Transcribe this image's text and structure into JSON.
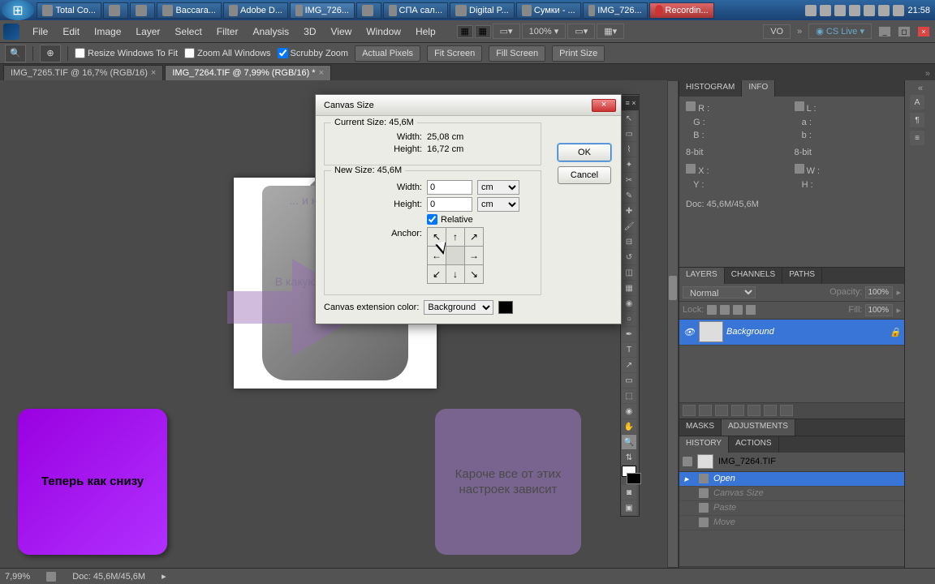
{
  "taskbar": {
    "items": [
      {
        "label": "Total Co..."
      },
      {
        "label": ""
      },
      {
        "label": ""
      },
      {
        "label": "Baccara..."
      },
      {
        "label": "Adobe D..."
      },
      {
        "label": "IMG_726..."
      },
      {
        "label": ""
      },
      {
        "label": "СПА сал..."
      },
      {
        "label": "Digital P..."
      },
      {
        "label": "Сумки - ..."
      },
      {
        "label": "IMG_726..."
      },
      {
        "label": "Recordin..."
      }
    ],
    "clock": "21:58"
  },
  "menu": {
    "items": [
      "File",
      "Edit",
      "Image",
      "Layer",
      "Select",
      "Filter",
      "Analysis",
      "3D",
      "View",
      "Window",
      "Help"
    ],
    "zoom": "100% ▾",
    "cslive": "CS Live ▾",
    "vo": "VO"
  },
  "options": {
    "resize": "Resize Windows To Fit",
    "zoomAll": "Zoom All Windows",
    "scrubby": "Scrubby Zoom",
    "btns": [
      "Actual Pixels",
      "Fit Screen",
      "Fill Screen",
      "Print Size"
    ]
  },
  "tabs": {
    "t0": "IMG_7265.TIF @ 16,7% (RGB/16)",
    "t1": "IMG_7264.TIF @ 7,99% (RGB/16) *"
  },
  "anno": {
    "a1": "Теперь как снизу",
    "a2": "Кароче все от этих настроек зависит",
    "arr1": "... и на сколько",
    "arr2": "В какую сторону граница"
  },
  "dialog": {
    "title": "Canvas Size",
    "ok": "OK",
    "cancel": "Cancel",
    "currentSize": "Current Size: 45,6M",
    "widthL": "Width:",
    "widthV": "25,08 cm",
    "heightL": "Height:",
    "heightV": "16,72 cm",
    "newSize": "New Size: 45,6M",
    "newWidthL": "Width:",
    "newWidthV": "0",
    "newWidthU": "cm",
    "newHeightL": "Height:",
    "newHeightV": "0",
    "newHeightU": "cm",
    "relative": "Relative",
    "anchor": "Anchor:",
    "extColor": "Canvas extension color:",
    "extVal": "Background",
    "arrows": {
      "nw": "↖",
      "n": "↑",
      "ne": "↗",
      "w": "←",
      "c": "",
      "e": "→",
      "sw": "↙",
      "s": "↓",
      "se": "↘"
    }
  },
  "info": {
    "tabHist": "HISTOGRAM",
    "tabInfo": "INFO",
    "r": "R :",
    "g": "G :",
    "b": "B :",
    "l": "L :",
    "a": "a :",
    "b2": "b :",
    "bit1": "8-bit",
    "bit2": "8-bit",
    "x": "X :",
    "y": "Y :",
    "w": "W :",
    "h": "H :",
    "doc": "Doc: 45,6M/45,6M"
  },
  "layers": {
    "tabL": "LAYERS",
    "tabC": "CHANNELS",
    "tabP": "PATHS",
    "mode": "Normal",
    "opL": "Opacity:",
    "opV": "100%",
    "lockL": "Lock:",
    "fillL": "Fill:",
    "fillV": "100%",
    "bg": "Background"
  },
  "masks": {
    "tab1": "MASKS",
    "tab2": "ADJUSTMENTS"
  },
  "history": {
    "tab1": "HISTORY",
    "tab2": "ACTIONS",
    "file": "IMG_7264.TIF",
    "items": [
      "Open",
      "Canvas Size",
      "Paste",
      "Move"
    ]
  },
  "status": {
    "zoom": "7,99%",
    "doc": "Doc: 45,6M/45,6M"
  }
}
